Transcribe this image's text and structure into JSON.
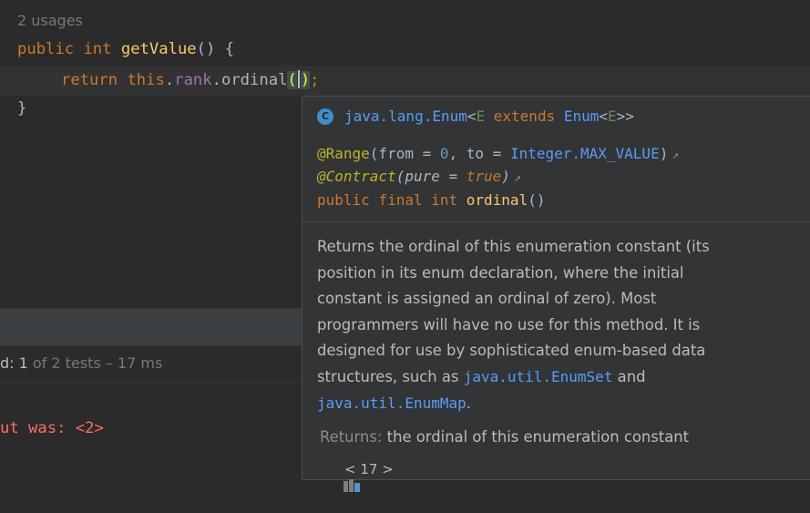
{
  "editor": {
    "usages": "2 usages",
    "line1": {
      "kw_public": "public",
      "kw_int": "int",
      "method": "getValue",
      "rest": "() {"
    },
    "line2": {
      "kw_return": "return",
      "kw_this": "this",
      "dot1": ".",
      "field": "rank",
      "dot2": ".",
      "call": "ordinal",
      "open": "(",
      "close": ")",
      "semi": ";"
    },
    "line3": "}"
  },
  "test_panel": {
    "status_prefix": "d: 1",
    "status_rest": " of 2 tests – 17 ms",
    "output": "ut was: <2>"
  },
  "doc_popup": {
    "class_icon_letter": "C",
    "signature": {
      "type": "java.lang.Enum",
      "lt": "<",
      "param": "E",
      "extends": " extends ",
      "bound": "Enum",
      "lt2": "<",
      "param2": "E",
      "gt": ">>"
    },
    "decl1": {
      "annotation": "@Range",
      "open": "(from = ",
      "from_val": "0",
      "mid": ", to = ",
      "to_val": "Integer.MAX_VALUE",
      "close": ")"
    },
    "decl2": {
      "annotation": "@Contract",
      "open": "(pure = ",
      "val": "true",
      "close": ")"
    },
    "decl3": {
      "mods": "public final int ",
      "name": "ordinal",
      "params": "()"
    },
    "description_text": "Returns the ordinal of this enumeration constant (its position in its enum declaration, where the initial constant is assigned an ordinal of zero). Most programmers will have no use for this method. It is designed for use by sophisticated enum-based data structures, such as ",
    "link1": "java.util.EnumSet",
    "and_text": " and ",
    "link2": "java.util.EnumMap",
    "period": ".",
    "returns_label": "Returns:",
    "returns_text": " the ordinal of this enumeration constant",
    "footer": "< 17 >"
  },
  "icons": {
    "class": "class-c-icon",
    "external_link": "external-link-icon",
    "library": "library-icon"
  },
  "colors": {
    "editor_bg": "#2b2b2b",
    "keyword": "#cc7832",
    "method": "#ffc66d",
    "field": "#9876aa",
    "annotation": "#bbb529",
    "link": "#589df6",
    "error": "#ff6b68"
  }
}
